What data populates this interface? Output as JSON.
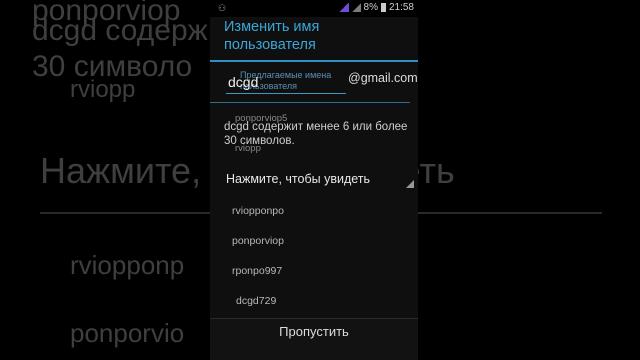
{
  "background": {
    "line1": "ponporviop",
    "line2": "dcgd содерж",
    "line3": "30 символо",
    "line4": "rviopp",
    "line5": "Нажмите, чтобы увидеть",
    "line6": "rviopponp",
    "line7": "ponporvio"
  },
  "status_bar": {
    "battery": "8%",
    "time": "21:58"
  },
  "dialog": {
    "title": "Изменить имя пользователя",
    "username": "dcgd",
    "suggest_hint": "Предлагаемые имена пользователя",
    "domain": "@gmail.com",
    "suggestions": [
      "ponporviop5",
      "rviopp"
    ],
    "error": "dcgd содержит менее 6 или более 30 символов.",
    "tap_label": "Нажмите, чтобы увидеть",
    "list_items": [
      "rviopponpo",
      "ponporviop",
      "rponpo997",
      "dcgd729"
    ],
    "skip_label": "Пропустить"
  }
}
